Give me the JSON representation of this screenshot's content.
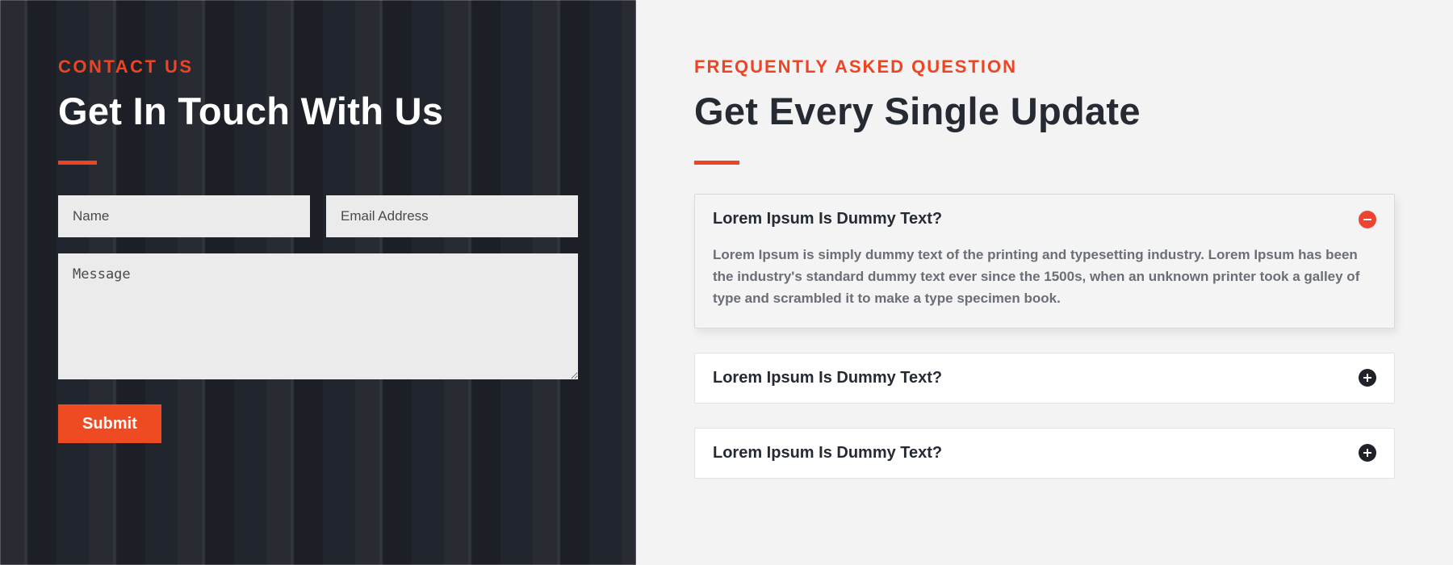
{
  "contact": {
    "eyebrow": "CONTACT US",
    "title": "Get In Touch With Us",
    "name_placeholder": "Name",
    "email_placeholder": "Email Address",
    "message_placeholder": "Message",
    "submit_label": "Submit"
  },
  "faq": {
    "eyebrow": "FREQUENTLY ASKED QUESTION",
    "title": "Get Every Single Update",
    "items": [
      {
        "question": "Lorem Ipsum Is Dummy Text?",
        "answer": "Lorem Ipsum is simply dummy text of the printing and typesetting industry. Lorem Ipsum has been the industry's standard dummy text ever since the 1500s, when an unknown printer took a galley of type and scrambled it to make a type specimen book.",
        "open": true
      },
      {
        "question": "Lorem Ipsum Is Dummy Text?",
        "open": false
      },
      {
        "question": "Lorem Ipsum Is Dummy Text?",
        "open": false
      }
    ]
  }
}
